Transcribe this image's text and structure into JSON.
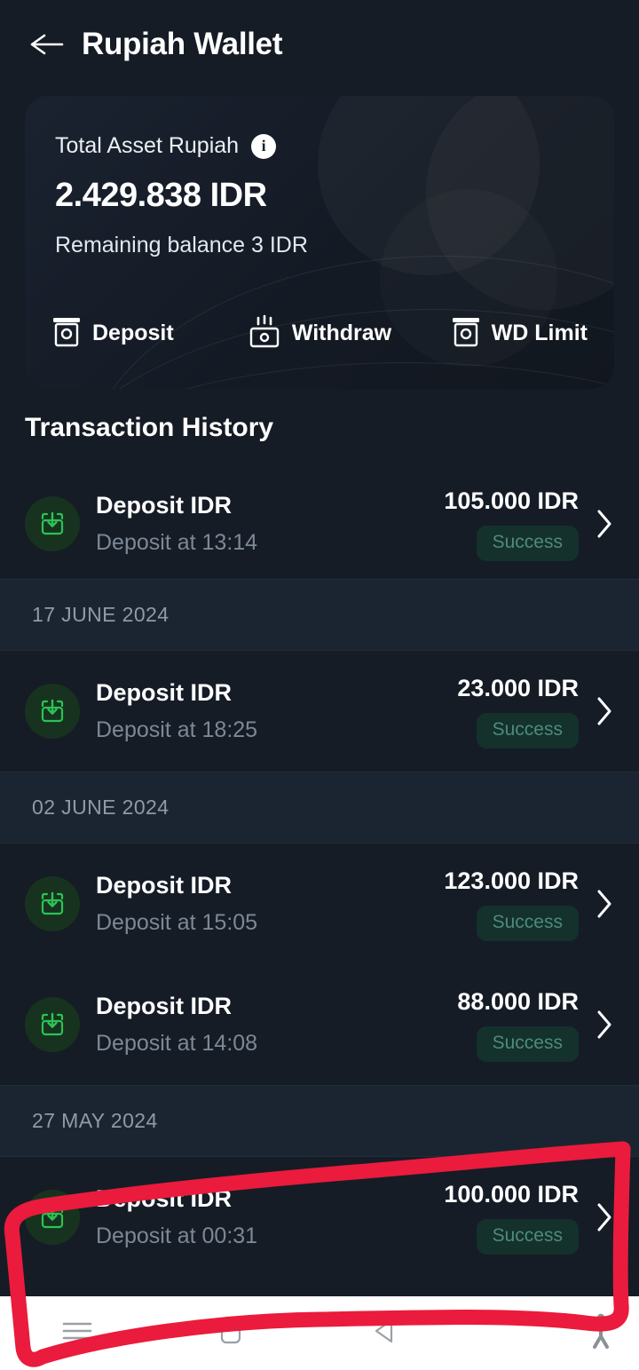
{
  "header": {
    "title": "Rupiah Wallet",
    "back_icon": "arrow-left-icon"
  },
  "balance_card": {
    "label": "Total Asset Rupiah",
    "info_icon": "info-icon",
    "info_glyph": "i",
    "amount": "2.429.838 IDR",
    "remaining": "Remaining balance 3 IDR",
    "actions": [
      {
        "label": "Deposit",
        "icon": "deposit-machine-icon"
      },
      {
        "label": "Withdraw",
        "icon": "withdraw-machine-icon"
      },
      {
        "label": "WD Limit",
        "icon": "wd-limit-machine-icon"
      }
    ]
  },
  "transactions": {
    "section_title": "Transaction History",
    "groups": [
      {
        "date": null,
        "rows": [
          {
            "title": "Deposit IDR",
            "subtitle": "Deposit at 13:14",
            "amount": "105.000 IDR",
            "status": "Success",
            "icon": "deposit-arrow-icon",
            "chevron_icon": "chevron-right-icon"
          }
        ]
      },
      {
        "date": "17 JUNE 2024",
        "rows": [
          {
            "title": "Deposit IDR",
            "subtitle": "Deposit at 18:25",
            "amount": "23.000 IDR",
            "status": "Success",
            "icon": "deposit-arrow-icon",
            "chevron_icon": "chevron-right-icon"
          }
        ]
      },
      {
        "date": "02 JUNE 2024",
        "rows": [
          {
            "title": "Deposit IDR",
            "subtitle": "Deposit at 15:05",
            "amount": "123.000 IDR",
            "status": "Success",
            "icon": "deposit-arrow-icon",
            "chevron_icon": "chevron-right-icon"
          },
          {
            "title": "Deposit IDR",
            "subtitle": "Deposit at 14:08",
            "amount": "88.000 IDR",
            "status": "Success",
            "icon": "deposit-arrow-icon",
            "chevron_icon": "chevron-right-icon"
          }
        ]
      },
      {
        "date": "27 MAY 2024",
        "rows": [
          {
            "title": "Deposit IDR",
            "subtitle": "Deposit at 00:31",
            "amount": "100.000 IDR",
            "status": "Success",
            "icon": "deposit-arrow-icon",
            "chevron_icon": "chevron-right-icon"
          }
        ]
      }
    ]
  },
  "navbar": {
    "items": [
      {
        "icon": "recents-menu-icon"
      },
      {
        "icon": "home-square-icon"
      },
      {
        "icon": "back-triangle-icon"
      },
      {
        "icon": "accessibility-person-icon"
      }
    ]
  },
  "annotation": {
    "type": "hand-drawn-rectangle",
    "color": "#ea1b3c",
    "target": "last-transaction-row-and-navbar"
  },
  "colors": {
    "page_background": "#151c25",
    "row_background": "#151c26",
    "date_band": "#1b2531",
    "accent_green": "#2bc355",
    "badge_background": "#14312c",
    "badge_text": "#4e8a7d",
    "annotation_red": "#ea1b3c",
    "navbar_background": "#ffffff"
  }
}
